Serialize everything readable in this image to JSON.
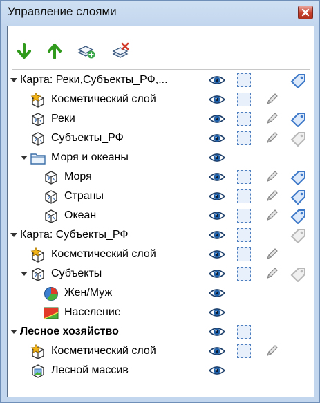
{
  "window": {
    "title": "Управление слоями"
  },
  "toolbar": [
    {
      "name": "move-down-button",
      "icon": "arrow-down-icon"
    },
    {
      "name": "move-up-button",
      "icon": "arrow-up-icon"
    },
    {
      "name": "add-layer-button",
      "icon": "add-layer-icon"
    },
    {
      "name": "remove-layer-button",
      "icon": "remove-layer-icon"
    }
  ],
  "tree": [
    {
      "label": "Карта: Реки,Субъекты_РФ,...",
      "level": 0,
      "arrow": "open",
      "icon": "none",
      "eye": true,
      "sel": true,
      "pencil": false,
      "tag": "blue"
    },
    {
      "label": "Косметический слой",
      "level": 1,
      "arrow": "none",
      "icon": "cosmetic-layer-icon",
      "eye": true,
      "sel": true,
      "pencil": true,
      "tag": "none"
    },
    {
      "label": "Реки",
      "level": 1,
      "arrow": "none",
      "icon": "vector-layer-icon",
      "eye": true,
      "sel": true,
      "pencil": true,
      "tag": "blue"
    },
    {
      "label": "Субъекты_РФ",
      "level": 1,
      "arrow": "none",
      "icon": "vector-layer-icon",
      "eye": true,
      "sel": true,
      "pencil": true,
      "tag": "gray"
    },
    {
      "label": "Моря и океаны",
      "level": 1,
      "arrow": "open",
      "icon": "folder-icon",
      "eye": true,
      "sel": false,
      "pencil": false,
      "tag": "none"
    },
    {
      "label": "Моря",
      "level": 2,
      "arrow": "none",
      "icon": "vector-layer-icon",
      "eye": true,
      "sel": true,
      "pencil": true,
      "tag": "blue"
    },
    {
      "label": "Страны",
      "level": 2,
      "arrow": "none",
      "icon": "vector-layer-icon",
      "eye": true,
      "sel": true,
      "pencil": true,
      "tag": "blue"
    },
    {
      "label": "Океан",
      "level": 2,
      "arrow": "none",
      "icon": "vector-layer-icon",
      "eye": true,
      "sel": true,
      "pencil": true,
      "tag": "blue"
    },
    {
      "label": "Карта: Субъекты_РФ",
      "level": 0,
      "arrow": "open",
      "icon": "none",
      "eye": true,
      "sel": true,
      "pencil": false,
      "tag": "gray"
    },
    {
      "label": "Косметический слой",
      "level": 1,
      "arrow": "none",
      "icon": "cosmetic-layer-icon",
      "eye": true,
      "sel": true,
      "pencil": true,
      "tag": "none"
    },
    {
      "label": "Субъекты",
      "level": 1,
      "arrow": "open",
      "icon": "vector-layer-icon",
      "eye": true,
      "sel": true,
      "pencil": true,
      "tag": "gray"
    },
    {
      "label": "Жен/Муж",
      "level": 2,
      "arrow": "none",
      "icon": "pie-chart-icon",
      "eye": true,
      "sel": false,
      "pencil": false,
      "tag": "none"
    },
    {
      "label": "Население",
      "level": 2,
      "arrow": "none",
      "icon": "ranges-map-icon",
      "eye": true,
      "sel": false,
      "pencil": false,
      "tag": "none"
    },
    {
      "label": "Лесное хозяйство",
      "level": 0,
      "arrow": "open",
      "icon": "none",
      "bold": true,
      "eye": true,
      "sel": true,
      "pencil": false,
      "tag": "none"
    },
    {
      "label": "Косметический слой",
      "level": 1,
      "arrow": "none",
      "icon": "cosmetic-layer-icon",
      "eye": true,
      "sel": true,
      "pencil": true,
      "tag": "none"
    },
    {
      "label": "Лесной массив",
      "level": 1,
      "arrow": "none",
      "icon": "raster-layer-icon",
      "eye": true,
      "sel": false,
      "pencil": false,
      "tag": "none"
    }
  ],
  "colors": {
    "accent": "#4f7fbf",
    "tag_blue": "#3d78c8",
    "tag_gray": "#b8b8b8",
    "arrow_green": "#2f9a1c"
  }
}
